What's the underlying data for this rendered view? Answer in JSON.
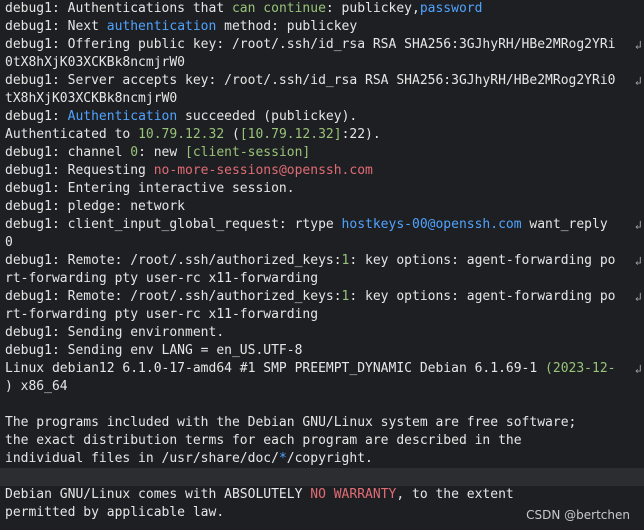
{
  "colors": {
    "background": "#1e1f22",
    "text": "#e6e6e6",
    "green": "#98c379",
    "blue": "#4fa3ff",
    "red": "#e06c75",
    "magenta": "#c678dd"
  },
  "icons": {
    "wrap": "line-wrap-icon"
  },
  "terminal": {
    "lines": [
      [
        {
          "t": "debug1: Authentications that "
        },
        {
          "t": "can continue",
          "c": "green"
        },
        {
          "t": ": publickey,"
        },
        {
          "t": "password",
          "c": "blue"
        }
      ],
      [
        {
          "t": "debug1: Next "
        },
        {
          "t": "authentication",
          "c": "blue"
        },
        {
          "t": " method: publickey"
        }
      ],
      [
        {
          "t": "debug1: Offering public key: /root/.ssh/id_rsa RSA SHA256:3GJhyRH/HBe2MRog2YRi"
        }
      ],
      [
        {
          "t": "0tX8hXjK03XCKBk8ncmjrW0"
        }
      ],
      [
        {
          "t": "debug1: Server accepts key: /root/.ssh/id_rsa RSA SHA256:3GJhyRH/HBe2MRog2YRi0"
        }
      ],
      [
        {
          "t": "tX8hXjK03XCKBk8ncmjrW0"
        }
      ],
      [
        {
          "t": "debug1: "
        },
        {
          "t": "Authentication",
          "c": "blue"
        },
        {
          "t": " succeeded (publickey)."
        }
      ],
      [
        {
          "t": "Authenticated to "
        },
        {
          "t": "10.79.12.32",
          "c": "green"
        },
        {
          "t": " ("
        },
        {
          "t": "[10.79.12.32]",
          "c": "green"
        },
        {
          "t": ":22)."
        }
      ],
      [
        {
          "t": "debug1: channel "
        },
        {
          "t": "0",
          "c": "green"
        },
        {
          "t": ": new "
        },
        {
          "t": "[client-session]",
          "c": "green"
        }
      ],
      [
        {
          "t": "debug1: Requesting "
        },
        {
          "t": "no-more-sessions@openssh.com",
          "c": "red"
        }
      ],
      [
        {
          "t": "debug1: Entering interactive session."
        }
      ],
      [
        {
          "t": "debug1: pledge: network"
        }
      ],
      [
        {
          "t": "debug1: client_input_global_request: rtype "
        },
        {
          "t": "hostkeys-00@openssh.com",
          "c": "blue"
        },
        {
          "t": " want_reply "
        }
      ],
      [
        {
          "t": "0",
          "c": "magenta"
        }
      ],
      [
        {
          "t": "debug1: Remote: /root/.ssh/authorized_keys:"
        },
        {
          "t": "1",
          "c": "green"
        },
        {
          "t": ": key options: agent-forwarding po"
        }
      ],
      [
        {
          "t": "rt-forwarding pty user-rc x11-forwarding"
        }
      ],
      [
        {
          "t": "debug1: Remote: /root/.ssh/authorized_keys:"
        },
        {
          "t": "1",
          "c": "green"
        },
        {
          "t": ": key options: agent-forwarding po"
        }
      ],
      [
        {
          "t": "rt-forwarding pty user-rc x11-forwarding"
        }
      ],
      [
        {
          "t": "debug1: Sending environment."
        }
      ],
      [
        {
          "t": "debug1: Sending env LANG = en_US.UTF-8"
        }
      ],
      [
        {
          "t": "Linux debian12 6.1.0-17-amd64 #1 SMP PREEMPT_DYNAMIC Debian 6.1.69-1 "
        },
        {
          "t": "(2023-12-",
          "c": "green"
        }
      ],
      [
        {
          "t": ") x86_64"
        }
      ],
      [],
      [
        {
          "t": "The programs included with the Debian GNU/Linux system are free software;"
        }
      ],
      [
        {
          "t": "the exact distribution terms for each program are described in the"
        }
      ],
      [
        {
          "t": "individual files in /usr/share/doc/"
        },
        {
          "t": "*",
          "c": "blue"
        },
        {
          "t": "/copyright."
        }
      ],
      [],
      [
        {
          "t": "Debian GNU/Linux comes with ABSOLUTELY "
        },
        {
          "t": "NO WARRANTY",
          "c": "red"
        },
        {
          "t": ", to the extent"
        }
      ],
      [
        {
          "t": "permitted by applicable law."
        }
      ]
    ],
    "wrap_rows": [
      2,
      4,
      12,
      14,
      16,
      20
    ],
    "highlight_row": 26,
    "wrap_glyph": "↲"
  },
  "watermark": "CSDN @bertchen"
}
